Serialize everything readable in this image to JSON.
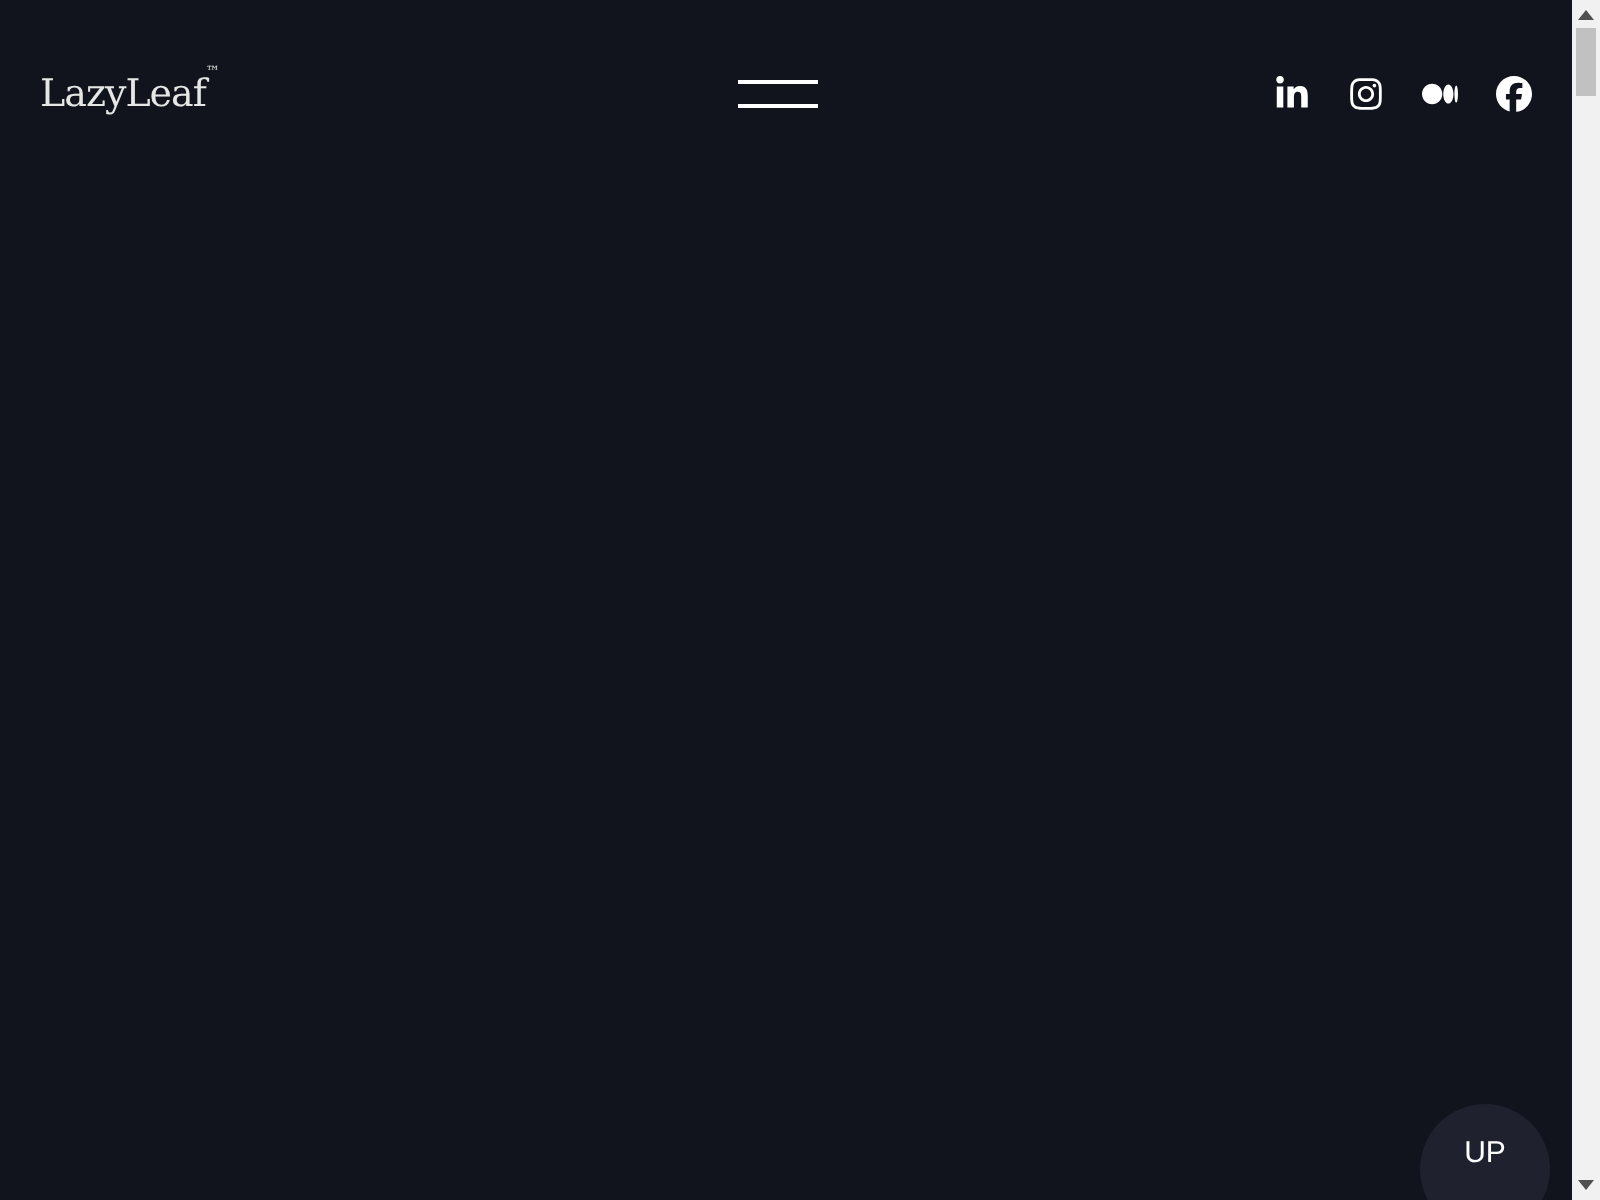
{
  "header": {
    "logo": "LazyLeaf$^{™}$",
    "social_links": [
      {
        "kind": "linkedin"
      },
      {
        "kind": "instagram"
      },
      {
        "kind": "medium"
      },
      {
        "kind": "facebook"
      }
    ]
  },
  "scroll_top_button": {
    "label": "UP"
  }
}
